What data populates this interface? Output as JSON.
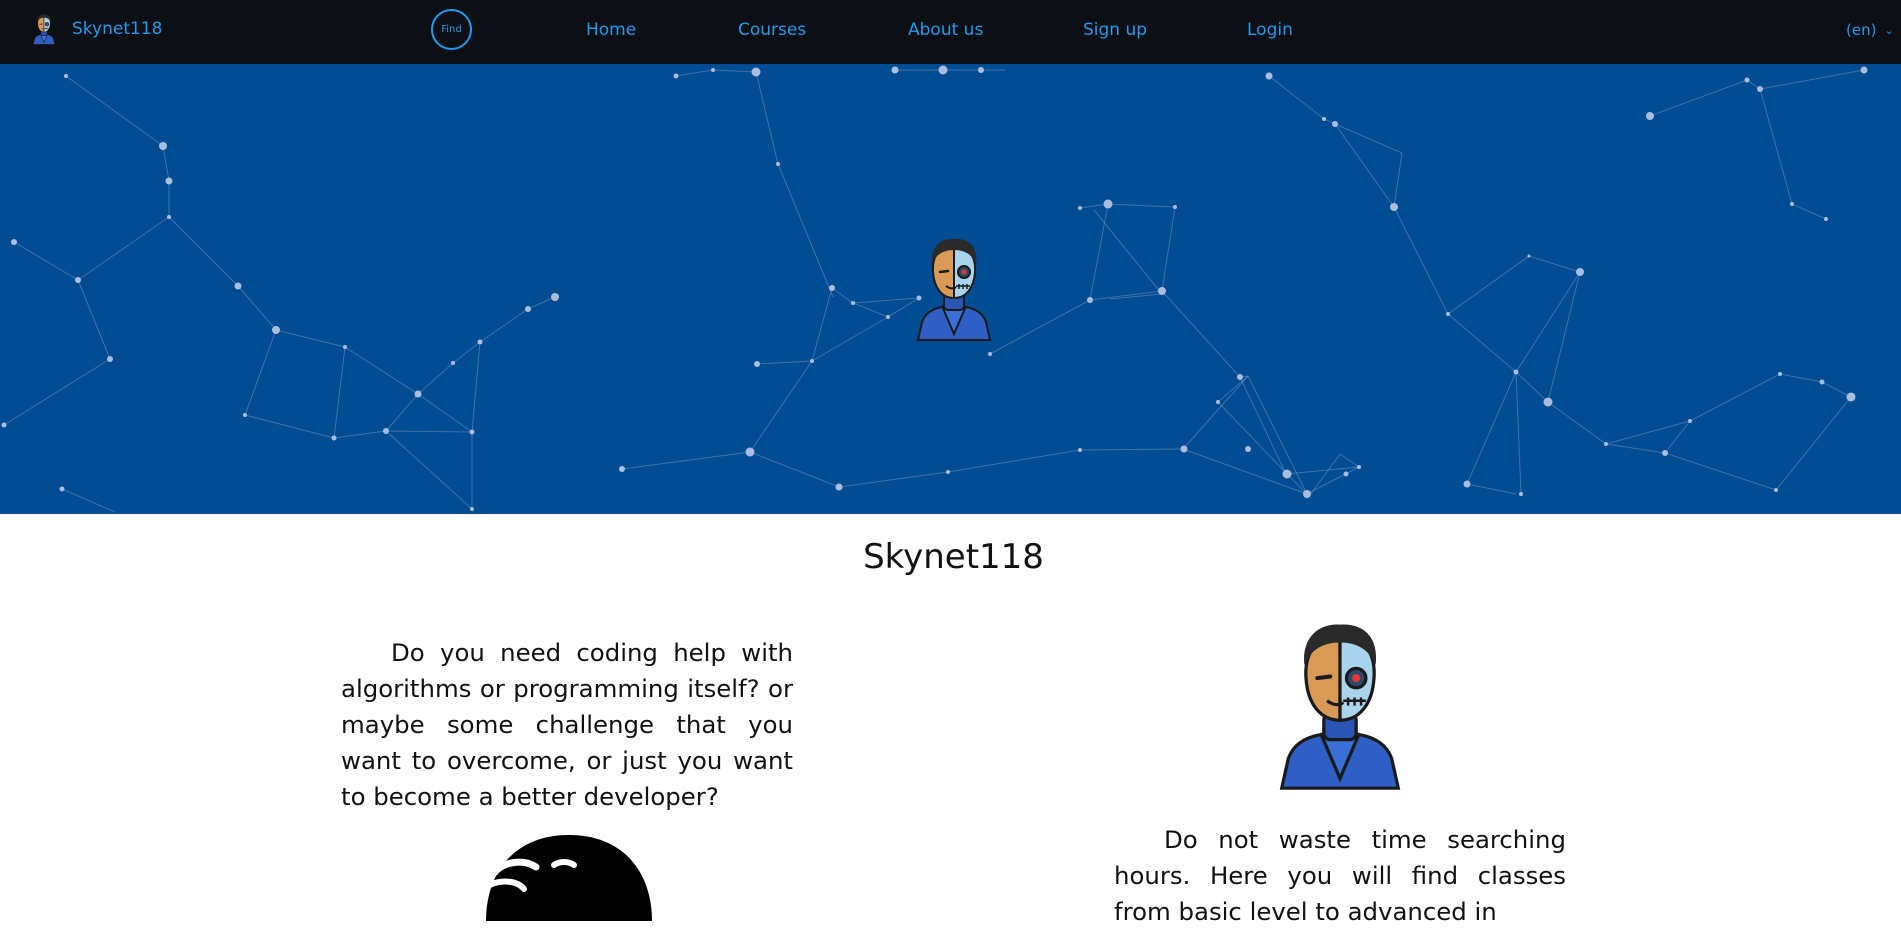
{
  "nav": {
    "brand": "Skynet118",
    "find_label": "Find",
    "links": [
      "Home",
      "Courses",
      "About us",
      "Sign up",
      "Login"
    ],
    "language": "(en)"
  },
  "colors": {
    "navbar_bg": "#0c0f14",
    "accent": "#1f9cf0",
    "hero_bg": "#014c92"
  },
  "main": {
    "title": "Skynet118",
    "intro_text": "Do you need coding help with algorithms or programming itself? or maybe some challenge that you want to overcome, or just you want to become a better developer?",
    "classes_text": "Do not waste time searching hours. Here you will find classes from basic level to advanced in"
  },
  "icons": [
    "cyborg-avatar-icon",
    "hacker-mask-icon",
    "chevron-down-icon"
  ]
}
